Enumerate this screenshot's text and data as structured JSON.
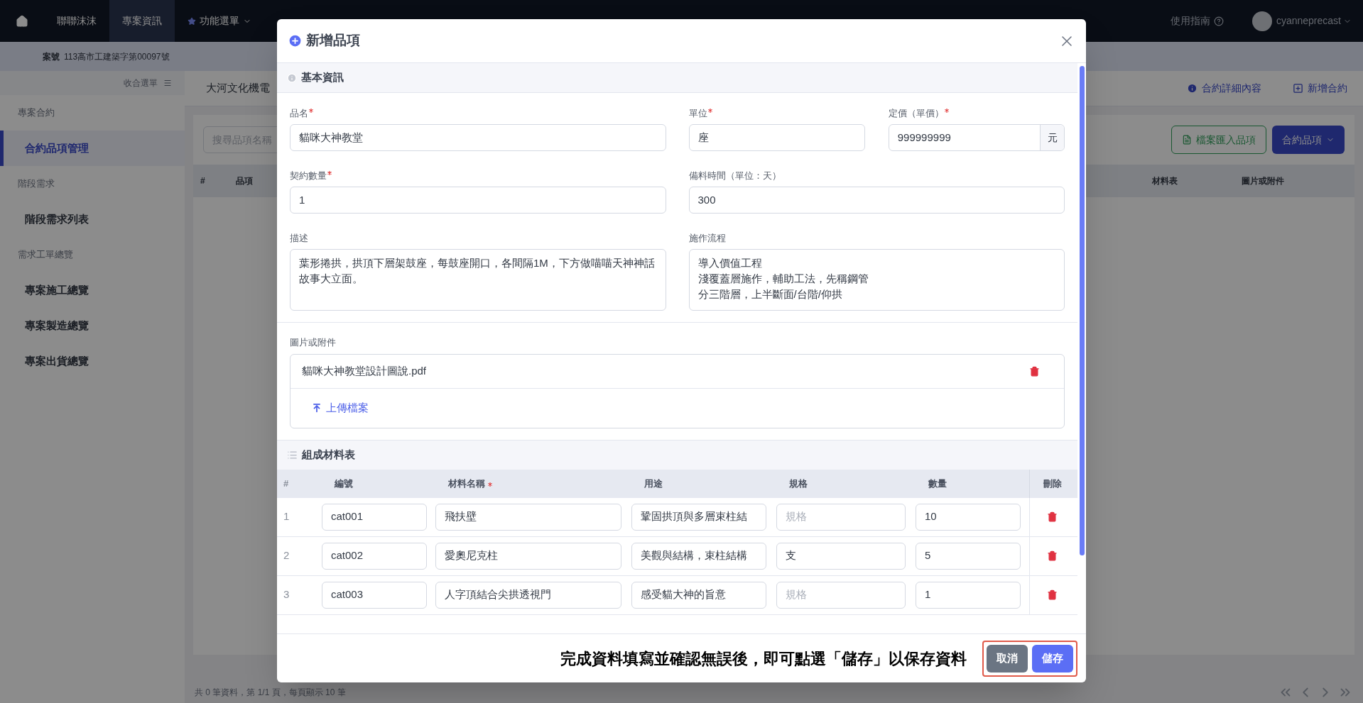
{
  "top_nav": {
    "items": [
      {
        "label": "聯聯沫沫",
        "selected": false,
        "kind": "link"
      },
      {
        "label": "專案資訊",
        "selected": true,
        "kind": "link"
      },
      {
        "label": "功能選單",
        "selected": false,
        "kind": "menu"
      }
    ],
    "help": "使用指南",
    "user": "cyanneprecast"
  },
  "project_bar": {
    "label": "案號",
    "value": "113高市工建築字第00097號"
  },
  "sidebar": {
    "collapse": "收合選單",
    "groups": [
      {
        "title": "專案合約",
        "items": [
          {
            "label": "合約品項管理",
            "selected": true
          }
        ]
      },
      {
        "title": "階段需求",
        "items": [
          {
            "label": "階段需求列表",
            "selected": false
          }
        ]
      },
      {
        "title": "需求工單總覽",
        "items": [
          {
            "label": "專案施工總覽",
            "selected": false
          },
          {
            "label": "專案製造總覽",
            "selected": false
          },
          {
            "label": "專案出貨總覽",
            "selected": false
          }
        ]
      }
    ]
  },
  "page": {
    "tab": "大河文化機電",
    "actions": [
      "合約詳細內容",
      "新增合約"
    ],
    "search_placeholder": "搜尋品項名稱",
    "import_button": "檔案匯入品項",
    "menu_button": "合約品項",
    "columns_left": [
      "#",
      "品項"
    ],
    "columns_right": [
      "材料表",
      "圖片或附件"
    ],
    "footer": "共 0 筆資料，第 1/1 頁，每頁顯示 10 筆"
  },
  "modal": {
    "title": "新增品項",
    "basic": {
      "title": "基本資訊",
      "rows": [
        [
          {
            "label": "品名",
            "required": true,
            "value": "貓咪大神教堂",
            "kind": "text"
          },
          {
            "label": "單位",
            "required": true,
            "value": "座",
            "kind": "text"
          },
          {
            "label": "定價（單價）",
            "required": true,
            "value": "999999999",
            "suffix": "元",
            "kind": "suffix"
          }
        ],
        [
          {
            "label": "契約數量",
            "required": true,
            "value": "1",
            "kind": "text"
          },
          {
            "label": "備料時間（單位：天）",
            "required": false,
            "value": "300",
            "kind": "text"
          }
        ],
        [
          {
            "label": "描述",
            "required": false,
            "lines": [
              "葉形捲拱，拱頂下層架鼓座，每鼓座開口，各間隔1M，下方做喵喵天神神話故事大立面。"
            ],
            "kind": "textarea"
          },
          {
            "label": "施作流程",
            "required": false,
            "lines": [
              "導入價值工程",
              "淺覆蓋層施作，輔助工法，先稱鋼管",
              "分三階層，上半斷面/台階/仰拱"
            ],
            "kind": "textarea"
          }
        ]
      ]
    },
    "attachments": {
      "label": "圖片或附件",
      "files": [
        {
          "name": "貓咪大神教堂設計圖說.pdf"
        }
      ],
      "upload": "上傳檔案"
    },
    "materials": {
      "title": "組成材料表",
      "columns": [
        {
          "label": "#",
          "required": false
        },
        {
          "label": "編號",
          "required": false
        },
        {
          "label": "材料名稱",
          "required": true
        },
        {
          "label": "用途",
          "required": false
        },
        {
          "label": "規格",
          "required": false
        },
        {
          "label": "數量",
          "required": false
        },
        {
          "label": "刪除",
          "required": false
        }
      ],
      "rows": [
        {
          "index": "1",
          "code": "cat001",
          "name": "飛扶壁",
          "use": "鞏固拱頂與多層束柱結",
          "spec_placeholder": "規格",
          "qty": "10"
        },
        {
          "index": "2",
          "code": "cat002",
          "name": "愛奧尼克柱",
          "use": "美觀與結構，束柱結構",
          "spec": "支",
          "qty": "5"
        },
        {
          "index": "3",
          "code": "cat003",
          "name": "人字頂結合尖拱透視門",
          "use": "感受貓大神的旨意",
          "spec_placeholder": "規格",
          "qty": "1"
        }
      ]
    },
    "note": "完成資料填寫並確認無誤後，即可點選「儲存」以保存資料",
    "buttons": {
      "cancel": "取消",
      "save": "儲存"
    }
  }
}
